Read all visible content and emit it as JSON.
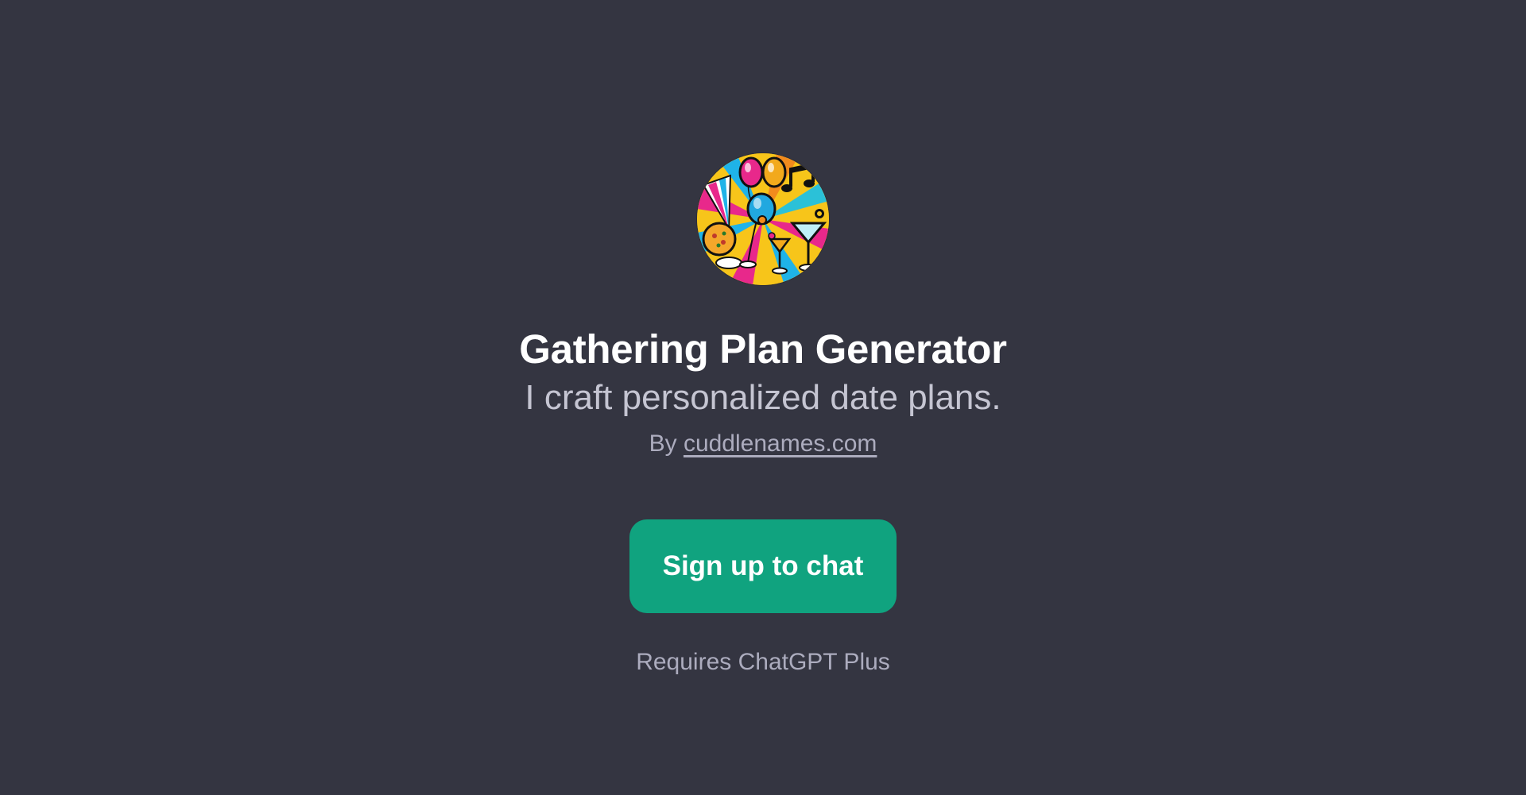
{
  "gpt": {
    "name": "Gathering Plan Generator",
    "description": "I craft personalized date plans.",
    "author_prefix": "By",
    "author": "cuddlenames.com",
    "avatar_icon": "party-celebration-icon"
  },
  "actions": {
    "signup_label": "Sign up to chat",
    "requirement_note": "Requires ChatGPT Plus"
  },
  "colors": {
    "background": "#343541",
    "button": "#10a37f",
    "title": "#ffffff",
    "subtitle": "#c5c5d2",
    "muted": "#acacbe"
  }
}
